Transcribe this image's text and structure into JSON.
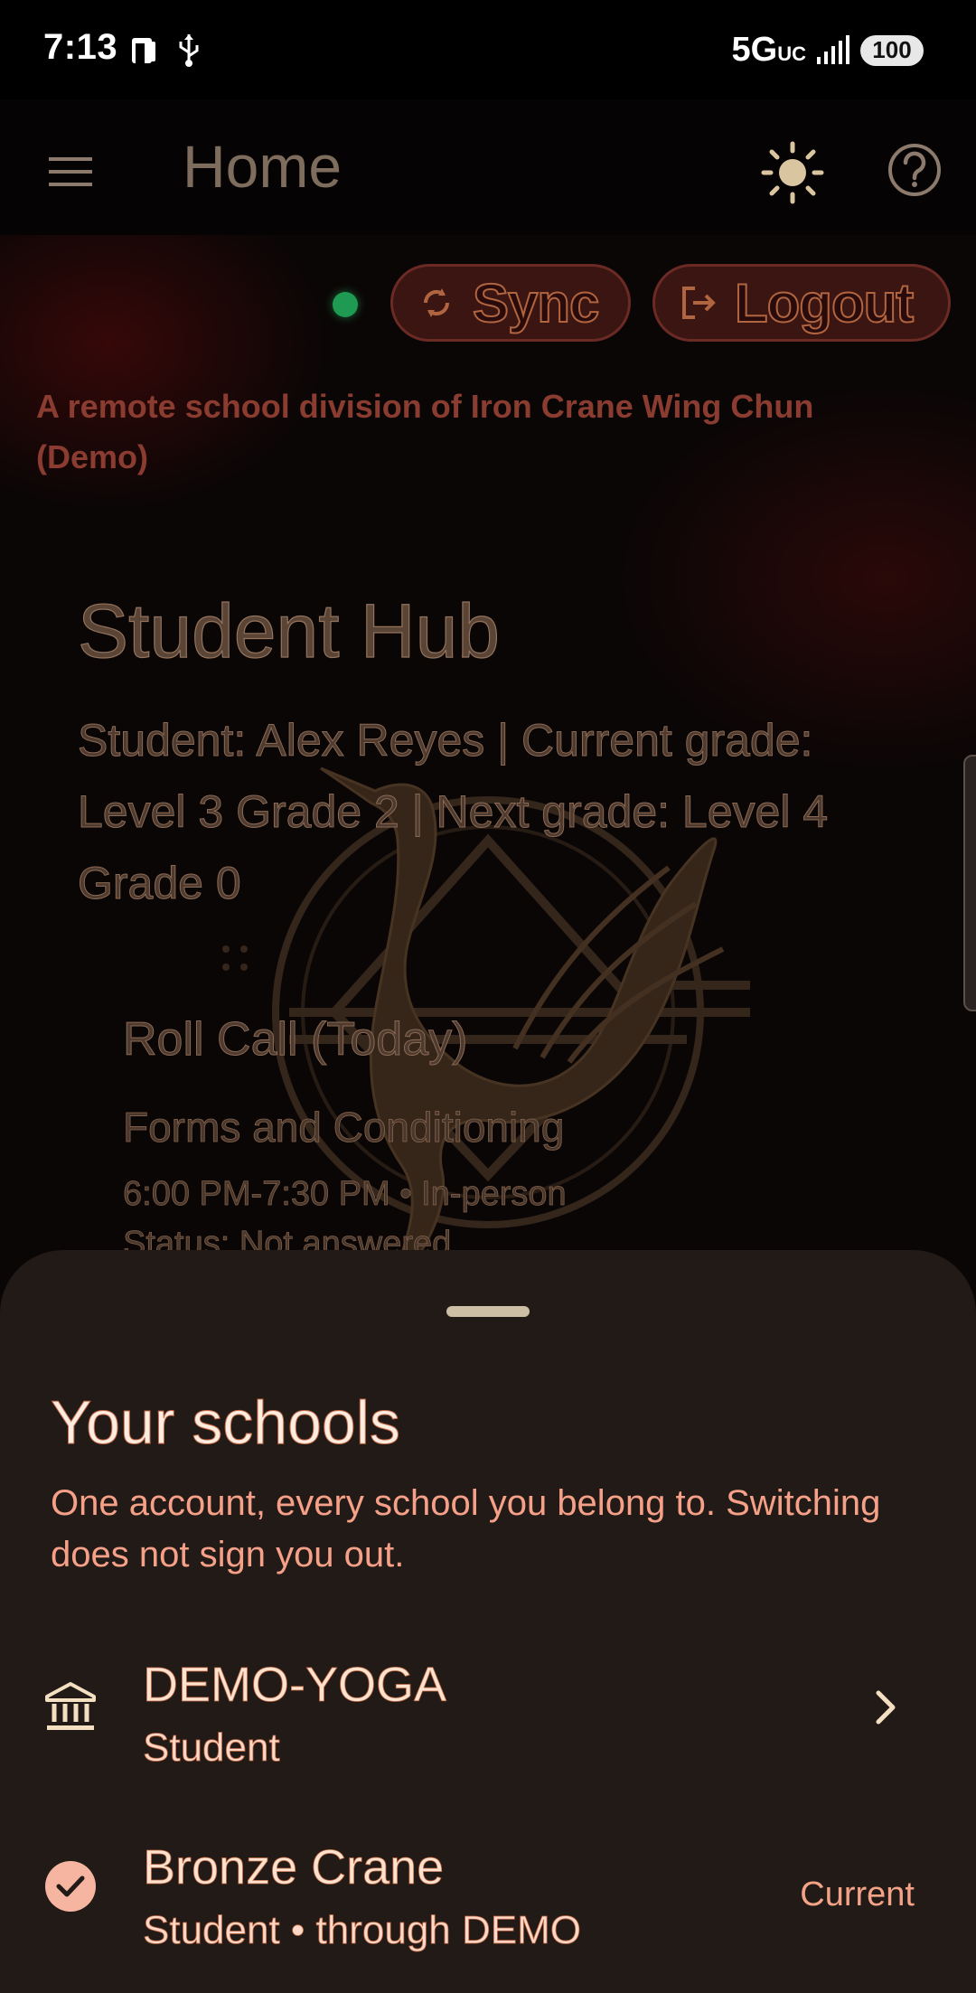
{
  "status_bar": {
    "time": "7:13",
    "network": "5G",
    "network_suffix": "UC",
    "battery": "100"
  },
  "app_bar": {
    "title": "Home",
    "menu_icon": "hamburger-menu-icon",
    "theme_icon": "sun-icon",
    "help_icon": "help-circle-icon"
  },
  "toolbar": {
    "sync_label": "Sync",
    "logout_label": "Logout",
    "online_color": "#1e9a52"
  },
  "school_info": {
    "division_text": "A remote school division of Iron Crane Wing Chun (Demo)"
  },
  "hub": {
    "title": "Student Hub",
    "info": "Student: Alex Reyes  |  Current grade: Level 3 Grade 2  |  Next grade: Level 4 Grade 0"
  },
  "roll_call": {
    "title": "Roll Call (Today)",
    "class_name": "Forms and Conditioning",
    "time": "6:00 PM-7:30 PM • In-person",
    "status": "Status: Not answered"
  },
  "sheet": {
    "title": "Your schools",
    "subtitle": "One account, every school you belong to. Switching does not sign you out.",
    "schools": [
      {
        "name": "DEMO-YOGA",
        "role": "Student",
        "icon": "bank-icon",
        "action_icon": "chevron-right-icon"
      },
      {
        "name": "Bronze Crane",
        "role": "Student • through DEMO",
        "icon": "check-circle-icon",
        "badge": "Current"
      }
    ]
  },
  "colors": {
    "background": "#000000",
    "sheet_background": "#221a17",
    "accent": "#f6a088"
  }
}
